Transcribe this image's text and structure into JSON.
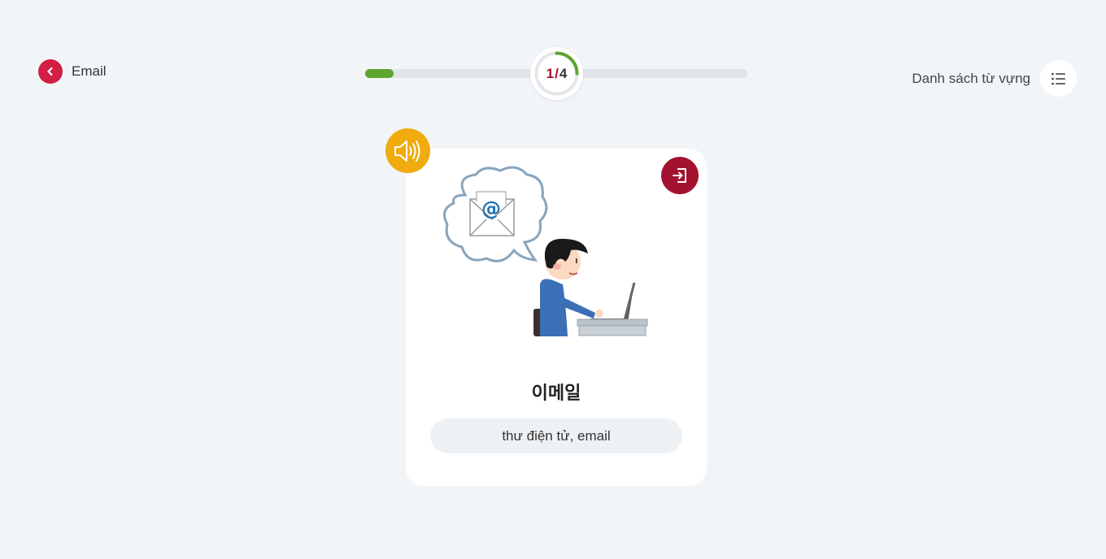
{
  "header": {
    "back_label": "Email",
    "progress": {
      "current": "1",
      "separator": "/",
      "total": "4",
      "fraction": 0.25
    },
    "vocab_list_label": "Danh sách từ vựng"
  },
  "card": {
    "word": "이메일",
    "meaning": "thư điện tử, email"
  },
  "icons": {
    "back": "chevron-left-icon",
    "list": "list-icon",
    "speaker": "speaker-icon",
    "exit": "exit-icon"
  },
  "colors": {
    "accent": "#d31e45",
    "dark_accent": "#a3122e",
    "progress": "#5ea52f",
    "speaker": "#f0ab0e"
  }
}
